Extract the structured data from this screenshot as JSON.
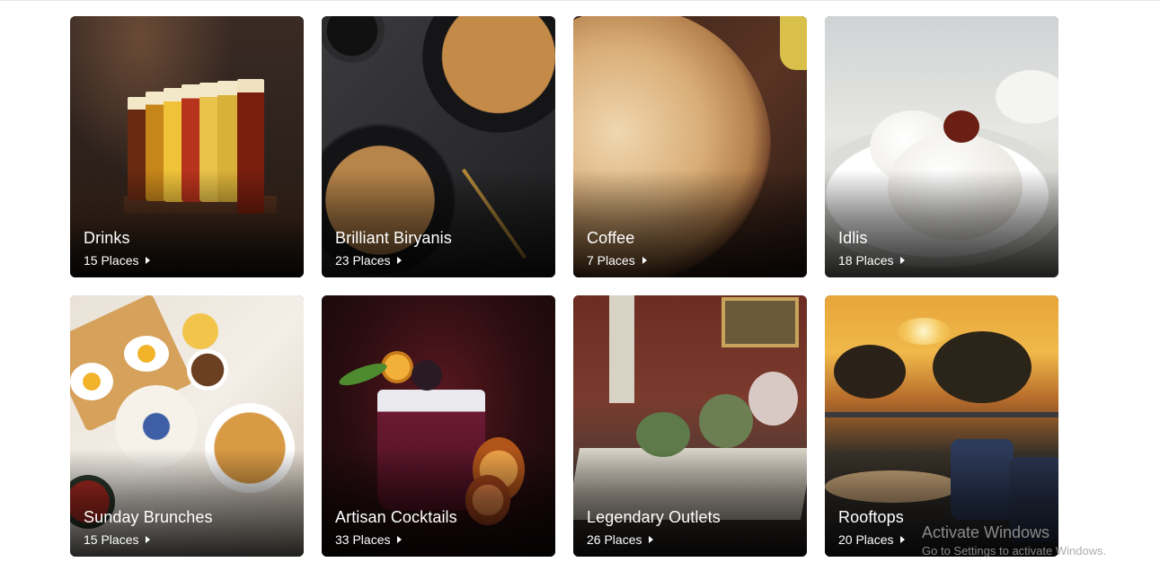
{
  "cards": [
    {
      "title": "Drinks",
      "count": "15 Places"
    },
    {
      "title": "Brilliant Biryanis",
      "count": "23 Places"
    },
    {
      "title": "Coffee",
      "count": "7 Places"
    },
    {
      "title": "Idlis",
      "count": "18 Places"
    },
    {
      "title": "Sunday Brunches",
      "count": "15 Places"
    },
    {
      "title": "Artisan Cocktails",
      "count": "33 Places"
    },
    {
      "title": "Legendary Outlets",
      "count": "26 Places"
    },
    {
      "title": "Rooftops",
      "count": "20 Places"
    }
  ],
  "watermark": {
    "title": "Activate Windows",
    "subtitle": "Go to Settings to activate Windows."
  },
  "colors": {
    "background": "#ffffff",
    "card_text": "#ffffff"
  }
}
